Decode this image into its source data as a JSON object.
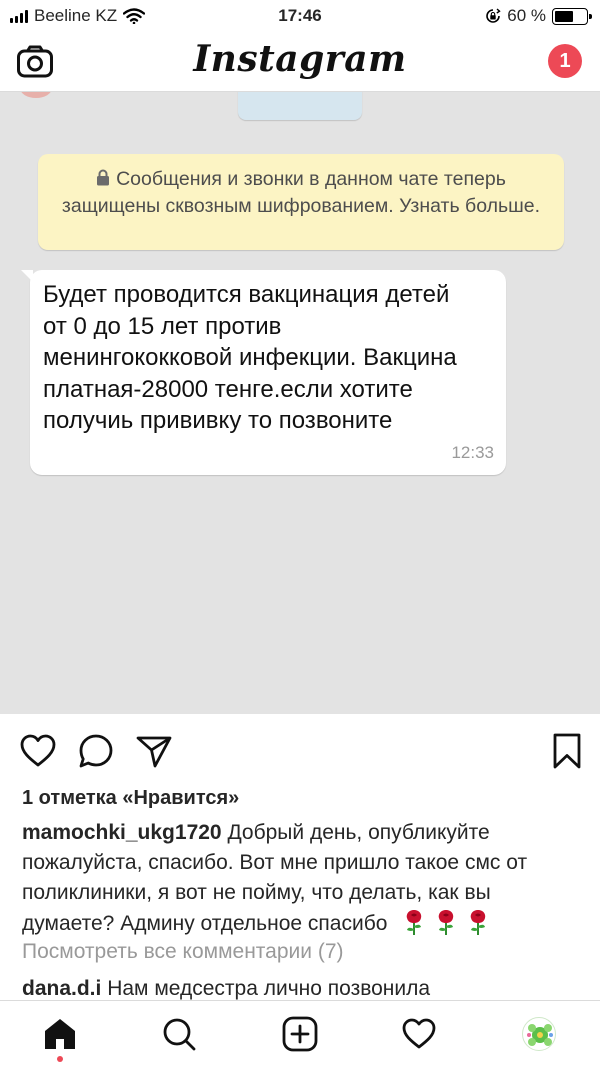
{
  "status_bar": {
    "carrier": "Beeline KZ",
    "time": "17:46",
    "battery_text": "60 %",
    "battery_level": 0.6,
    "icons": [
      "signal-bars-icon",
      "wifi-icon",
      "rotation-lock-icon",
      "battery-icon"
    ]
  },
  "header": {
    "logo_text": "Instagram",
    "notification_count": "1",
    "icons": [
      "camera-icon"
    ]
  },
  "post_image": {
    "encryption_notice": "Сообщения и звонки в данном чате теперь защищены сквозным шифрованием. Узнать больше.",
    "message_text": "Будет проводится вакцинация детей от 0 до 15 лет против менингококковой инфекции. Вакцина платная-28000 тенге.если хотите получиь прививку то позвоните",
    "message_time": "12:33",
    "colors": {
      "chat_background": "#e3e3e3",
      "notice_background": "#fcf4c4",
      "bubble_background": "#ffffff"
    }
  },
  "actions": {
    "icons": [
      "heart-icon",
      "comment-icon",
      "share-icon",
      "bookmark-icon"
    ]
  },
  "post": {
    "likes_text": "1 отметка «Нравится»",
    "caption_username": "mamochki_ukg1720",
    "caption_text": "Добрый день, опубликуйте пожалуйста, спасибо. Вот мне пришло такое смс от поликлиники, я вот не пойму, что делать, как вы думаете? Админу отдельное спасибо",
    "caption_emoji": [
      "rose-icon",
      "rose-icon",
      "rose-icon"
    ],
    "view_comments": "Посмотреть все комментарии (7)",
    "comment_username": "dana.d.i",
    "comment_text": "Нам медсестра лично позвонила"
  },
  "tab_bar": {
    "icons": [
      "home-icon",
      "search-icon",
      "new-post-icon",
      "activity-heart-icon",
      "profile-avatar"
    ],
    "accent": "#ed4956"
  }
}
